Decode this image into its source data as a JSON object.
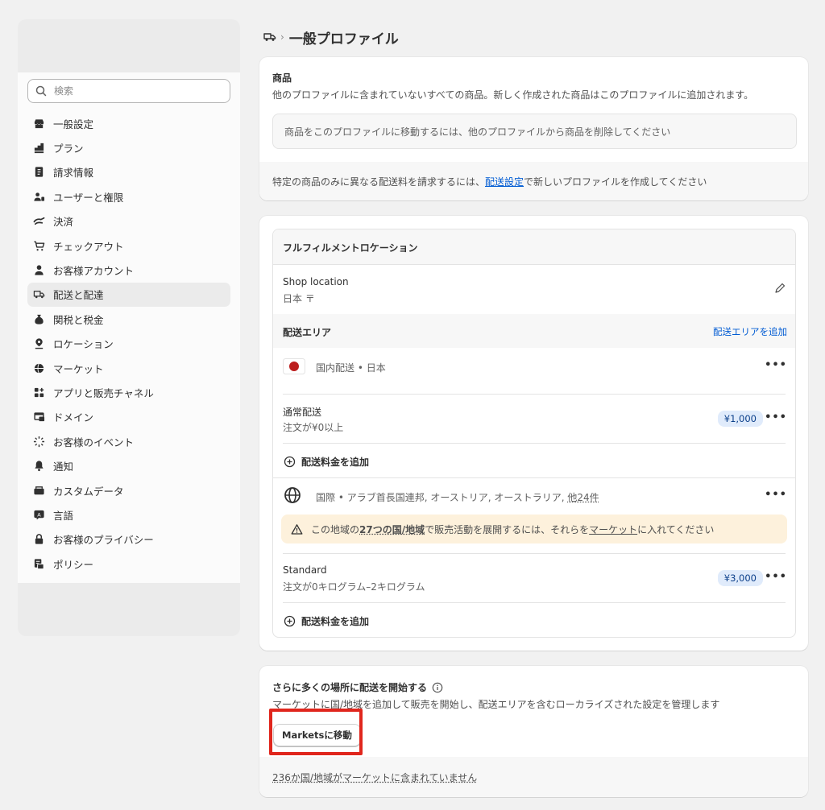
{
  "search": {
    "placeholder": "検索"
  },
  "sidebar": {
    "items": [
      {
        "label": "一般設定",
        "icon": "store-icon"
      },
      {
        "label": "プラン",
        "icon": "plan-icon"
      },
      {
        "label": "請求情報",
        "icon": "billing-icon"
      },
      {
        "label": "ユーザーと権限",
        "icon": "users-icon"
      },
      {
        "label": "決済",
        "icon": "payments-icon"
      },
      {
        "label": "チェックアウト",
        "icon": "cart-icon"
      },
      {
        "label": "お客様アカウント",
        "icon": "person-icon"
      },
      {
        "label": "配送と配達",
        "icon": "truck-icon",
        "active": true
      },
      {
        "label": "関税と税金",
        "icon": "tax-icon"
      },
      {
        "label": "ロケーション",
        "icon": "location-icon"
      },
      {
        "label": "マーケット",
        "icon": "globe-icon"
      },
      {
        "label": "アプリと販売チャネル",
        "icon": "apps-icon"
      },
      {
        "label": "ドメイン",
        "icon": "domain-icon"
      },
      {
        "label": "お客様のイベント",
        "icon": "events-icon"
      },
      {
        "label": "通知",
        "icon": "bell-icon"
      },
      {
        "label": "カスタムデータ",
        "icon": "data-icon"
      },
      {
        "label": "言語",
        "icon": "language-icon"
      },
      {
        "label": "お客様のプライバシー",
        "icon": "lock-icon"
      },
      {
        "label": "ポリシー",
        "icon": "policy-icon"
      }
    ]
  },
  "header": {
    "separator": "›",
    "title": "一般プロファイル"
  },
  "products": {
    "heading": "商品",
    "description": "他のプロファイルに含まれていないすべての商品。新しく作成された商品はこのプロファイルに追加されます。",
    "notice": "商品をこのプロファイルに移動するには、他のプロファイルから商品を削除してください",
    "footer_before": "特定の商品のみに異なる配送料を請求するには、",
    "footer_link": "配送設定",
    "footer_after": "で新しいプロファイルを作成してください"
  },
  "fulfillment": {
    "heading": "フルフィルメントロケーション",
    "location_name": "Shop location",
    "location_address": "日本 〒",
    "zones_heading": "配送エリア",
    "add_zone": "配送エリアを追加",
    "domestic": {
      "label": "国内配送 • 日本",
      "rate_name": "通常配送",
      "rate_condition": "注文が¥0以上",
      "price": "¥1,000"
    },
    "international": {
      "label_before": "国際 • アラブ首長国連邦, オーストリア, オーストラリア, ",
      "label_link": "他24件",
      "warning_before": "この地域の",
      "warning_strong": "27つの国/地域",
      "warning_middle": "で販売活動を展開するには、それらを",
      "warning_link": "マーケット",
      "warning_after": "に入れてください",
      "rate_name": "Standard",
      "rate_condition": "注文が0キログラム–2キログラム",
      "price": "¥3,000"
    },
    "add_rate": "配送料金を追加",
    "more": "•••"
  },
  "expand": {
    "heading": "さらに多くの場所に配送を開始する",
    "description": "マーケットに国/地域を追加して販売を開始し、配送エリアを含むローカライズされた設定を管理します",
    "button": "Marketsに移動",
    "footer": "236か国/地域がマーケットに含まれていません"
  },
  "colors": {
    "link": "#005bd3",
    "highlight": "#e0261d",
    "warning_bg": "#fdf1dc",
    "badge_bg": "#e0ebfb"
  }
}
